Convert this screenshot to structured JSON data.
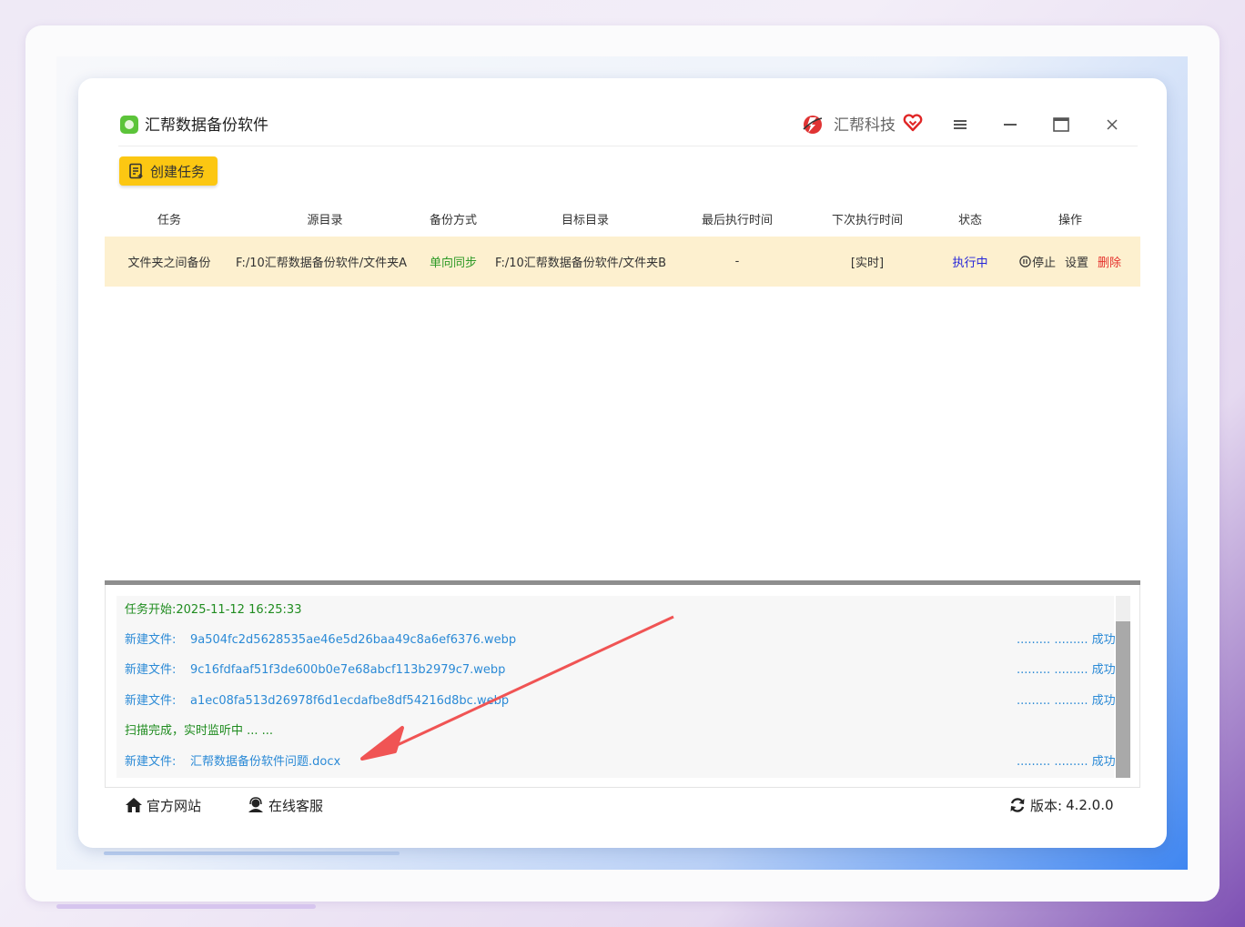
{
  "window": {
    "app_title": "汇帮数据备份软件",
    "brand_name": "汇帮科技"
  },
  "toolbar": {
    "create_task_label": "创建任务"
  },
  "table": {
    "columns": [
      "任务",
      "源目录",
      "备份方式",
      "目标目录",
      "最后执行时间",
      "下次执行时间",
      "状态",
      "操作"
    ],
    "rows": [
      {
        "task": "文件夹之间备份",
        "source": "F:/10汇帮数据备份软件/文件夹A",
        "mode": "单向同步",
        "target": "F:/10汇帮数据备份软件/文件夹B",
        "last_run": "-",
        "next_run": "[实时]",
        "status": "执行中",
        "actions": {
          "stop": "停止",
          "settings": "设置",
          "delete": "删除"
        }
      }
    ]
  },
  "log": {
    "lines": [
      {
        "prefix": "任务开始:",
        "text": "2025-11-12 16:25:33",
        "result": ""
      },
      {
        "prefix": "新建文件:",
        "text": "9a504fc2d5628535ae46e5d26baa49c8a6ef6376.webp",
        "result": "......... ......... 成功"
      },
      {
        "prefix": "新建文件:",
        "text": "9c16fdfaaf51f3de600b0e7e68abcf113b2979c7.webp",
        "result": "......... ......... 成功"
      },
      {
        "prefix": "新建文件:",
        "text": "a1ec08fa513d26978f6d1ecdafbe8df54216d8bc.webp",
        "result": "......... ......... 成功"
      },
      {
        "prefix": "扫描完成，实时监听中 ... ...",
        "text": "",
        "result": ""
      },
      {
        "prefix": "新建文件:",
        "text": "汇帮数据备份软件问题.docx",
        "result": "......... ......... 成功"
      }
    ]
  },
  "footer": {
    "official_site": "官方网站",
    "online_service": "在线客服",
    "version_label": "版本:",
    "version_value": "4.2.0.0"
  },
  "colors": {
    "accent_yellow": "#fcc712",
    "row_highlight": "#fdf0cf",
    "status_blue": "#2525d9",
    "mode_green": "#2e9a27",
    "delete_red": "#e5322d",
    "log_blue": "#2b8ad6",
    "log_green": "#1f8c1f",
    "annotation_arrow": "#f05454"
  }
}
